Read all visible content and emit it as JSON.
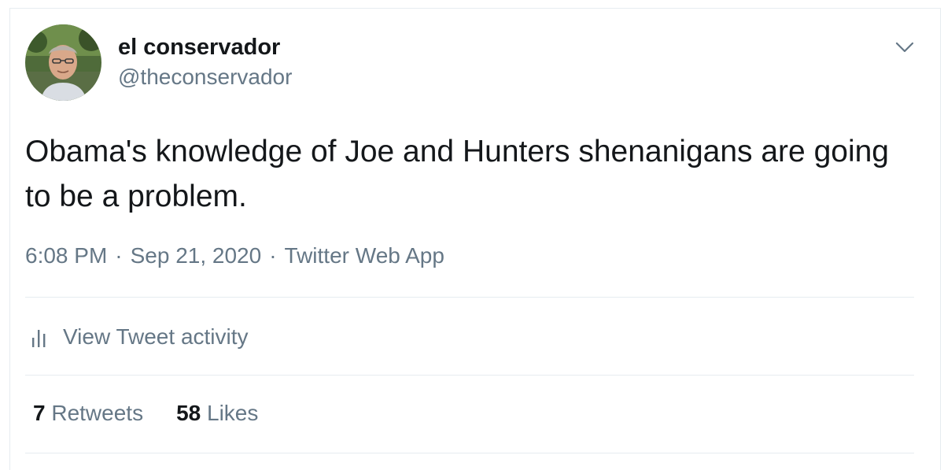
{
  "tweet": {
    "author": {
      "display_name": "el conservador",
      "handle": "@theconservador",
      "avatar_icon": "profile-photo-avatar"
    },
    "menu_icon": "chevron-down-icon",
    "text": "Obama's knowledge of Joe and Hunters shenanigans are going to be a problem.",
    "meta": {
      "time": "6:08 PM",
      "separator": "·",
      "date": "Sep 21, 2020",
      "source": "Twitter Web App"
    },
    "activity": {
      "icon": "bar-chart-icon",
      "label": "View Tweet activity"
    },
    "stats": {
      "retweets_count": "7",
      "retweets_label": "Retweets",
      "likes_count": "58",
      "likes_label": "Likes"
    }
  },
  "colors": {
    "primary_text": "#14171a",
    "secondary_text": "#657786",
    "divider": "#e6ecf0",
    "background": "#ffffff"
  }
}
